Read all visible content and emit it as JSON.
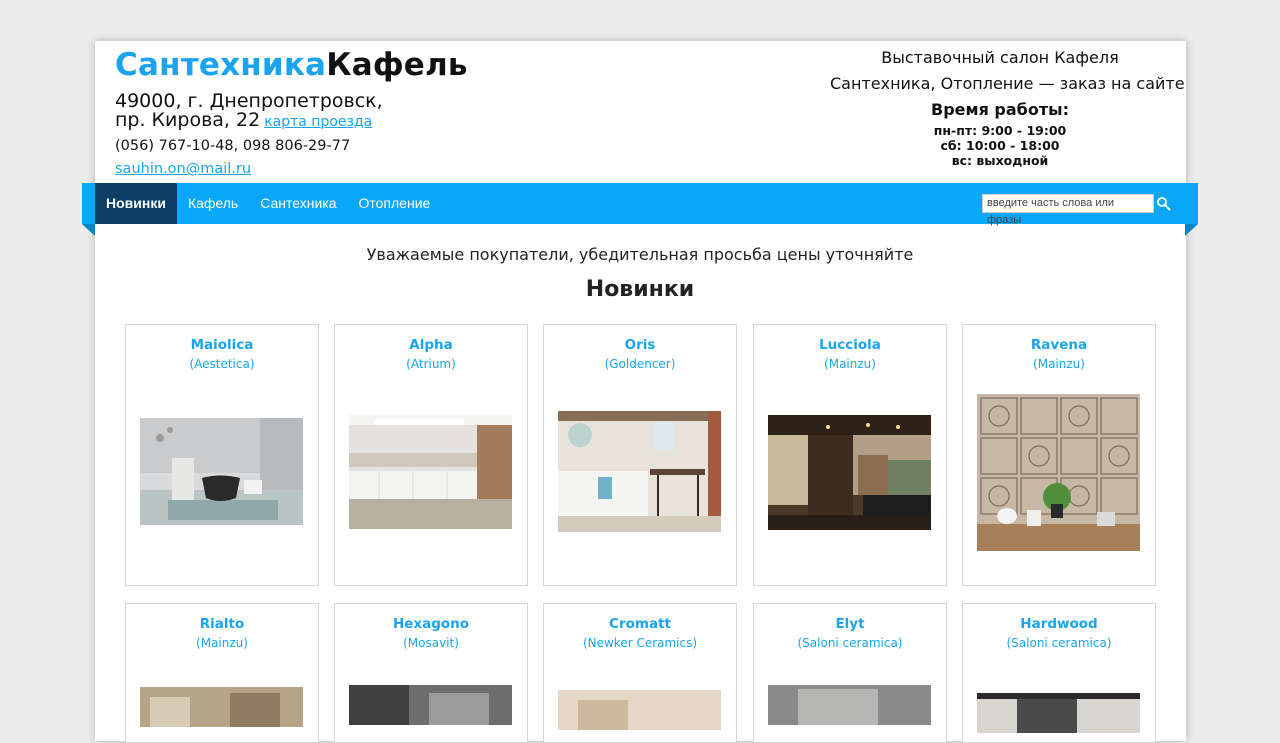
{
  "header": {
    "brand_part1": "Сантехника",
    "brand_part2": "Кафель",
    "address_line1": "49000, г. Днепропетровск,",
    "address_line2": "пр. Кирова, 22",
    "map_link": "карта проезда",
    "phones": "(056) 767-10-48, 098 806-29-77",
    "email": "sauhin.on@mail.ru",
    "right_line1": "Выставочный салон Кафеля",
    "right_line2": "Сантехника, Отопление — заказ на сайте",
    "hours_title": "Время работы:",
    "hours": [
      "пн-пт: 9:00 - 19:00",
      "сб: 10:00 - 18:00",
      "вс: выходной"
    ]
  },
  "nav": {
    "items": [
      "Новинки",
      "Кафель",
      "Сантехника",
      "Отопление"
    ],
    "active_index": 0,
    "search_placeholder": "введите часть слова или фразы"
  },
  "notice": "Уважаемые покупатели, убедительная просьба цены уточняйте",
  "section_title": "Новинки",
  "products": [
    {
      "name": "Maiolica",
      "brand": "(Aestetica)"
    },
    {
      "name": "Alpha",
      "brand": "(Atrium)"
    },
    {
      "name": "Oris",
      "brand": "(Goldencer)"
    },
    {
      "name": "Lucciola",
      "brand": "(Mainzu)"
    },
    {
      "name": "Ravena",
      "brand": "(Mainzu)"
    },
    {
      "name": "Rialto",
      "brand": "(Mainzu)"
    },
    {
      "name": "Hexagono",
      "brand": "(Mosavit)"
    },
    {
      "name": "Cromatt",
      "brand": "(Newker Ceramics)"
    },
    {
      "name": "Elyt",
      "brand": "(Saloni ceramica)"
    },
    {
      "name": "Hardwood",
      "brand": "(Saloni ceramica)"
    }
  ],
  "colors": {
    "accent": "#1aa3ef",
    "nav": "#0aa6f7",
    "nav_active": "#0c3e66"
  }
}
